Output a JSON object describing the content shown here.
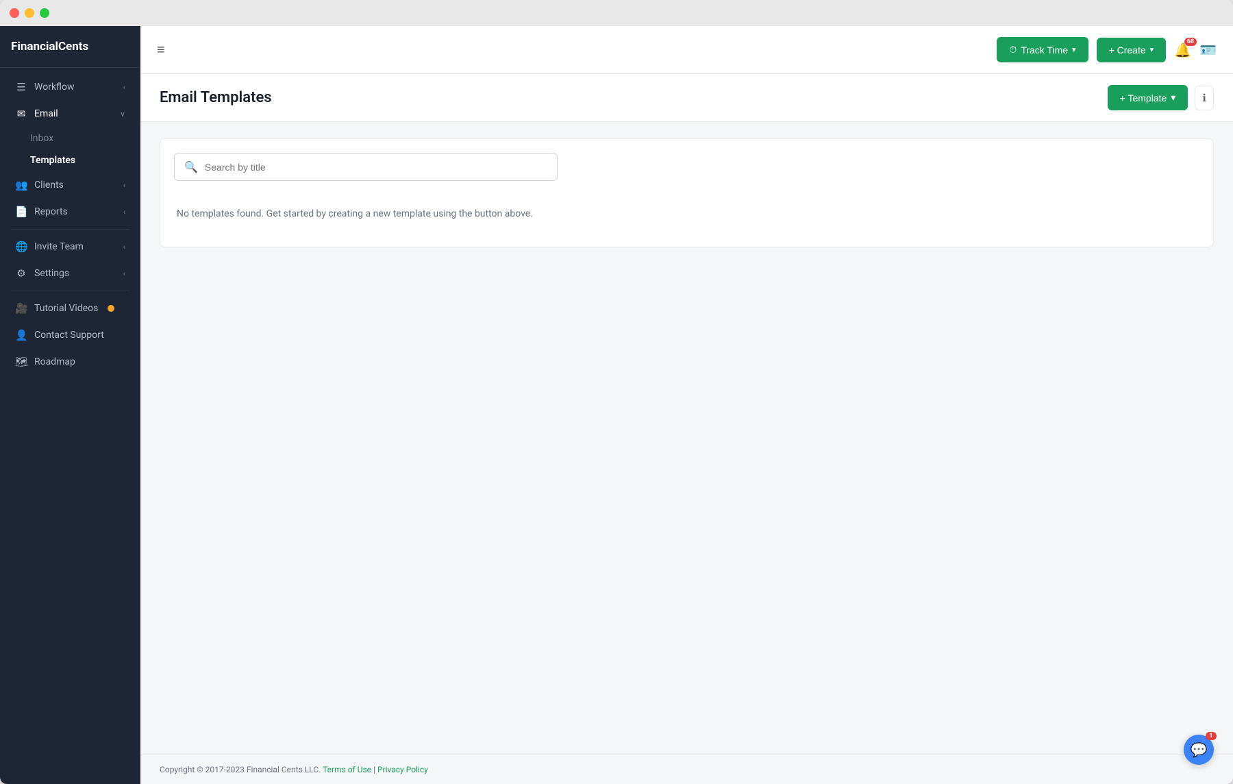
{
  "app": {
    "title": "FinancialCents"
  },
  "topbar": {
    "track_time_label": "Track Time",
    "create_label": "+ Create",
    "notification_count": "68",
    "chat_count": "1"
  },
  "page": {
    "title": "Email Templates",
    "template_button": "+ Template",
    "info_icon": "ℹ"
  },
  "search": {
    "placeholder": "Search by title"
  },
  "empty_state": {
    "message": "No templates found. Get started by creating a new template using the button above."
  },
  "sidebar": {
    "logo": "FinancialCents",
    "nav": [
      {
        "id": "workflow",
        "label": "Workflow",
        "icon": "☰",
        "has_chevron": true
      },
      {
        "id": "email",
        "label": "Email",
        "icon": "✉",
        "has_chevron": true,
        "active": true
      },
      {
        "id": "clients",
        "label": "Clients",
        "icon": "👥",
        "has_chevron": true
      },
      {
        "id": "reports",
        "label": "Reports",
        "icon": "📄",
        "has_chevron": true
      }
    ],
    "sub_nav": [
      {
        "id": "inbox",
        "label": "Inbox",
        "parent": "email"
      },
      {
        "id": "templates",
        "label": "Templates",
        "parent": "email",
        "active": true
      }
    ],
    "bottom_nav": [
      {
        "id": "invite-team",
        "label": "Invite Team",
        "icon": "🌐",
        "has_chevron": true
      },
      {
        "id": "settings",
        "label": "Settings",
        "icon": "⚙",
        "has_chevron": true
      },
      {
        "id": "tutorial-videos",
        "label": "Tutorial Videos",
        "icon": "🎥",
        "has_badge": true
      },
      {
        "id": "contact-support",
        "label": "Contact Support",
        "icon": "👤"
      },
      {
        "id": "roadmap",
        "label": "Roadmap",
        "icon": "🗺"
      }
    ]
  },
  "footer": {
    "copyright": "Copyright © 2017-2023 Financial Cents LLC.",
    "terms_label": "Terms of Use",
    "separator": "|",
    "privacy_label": "Privacy Policy"
  }
}
